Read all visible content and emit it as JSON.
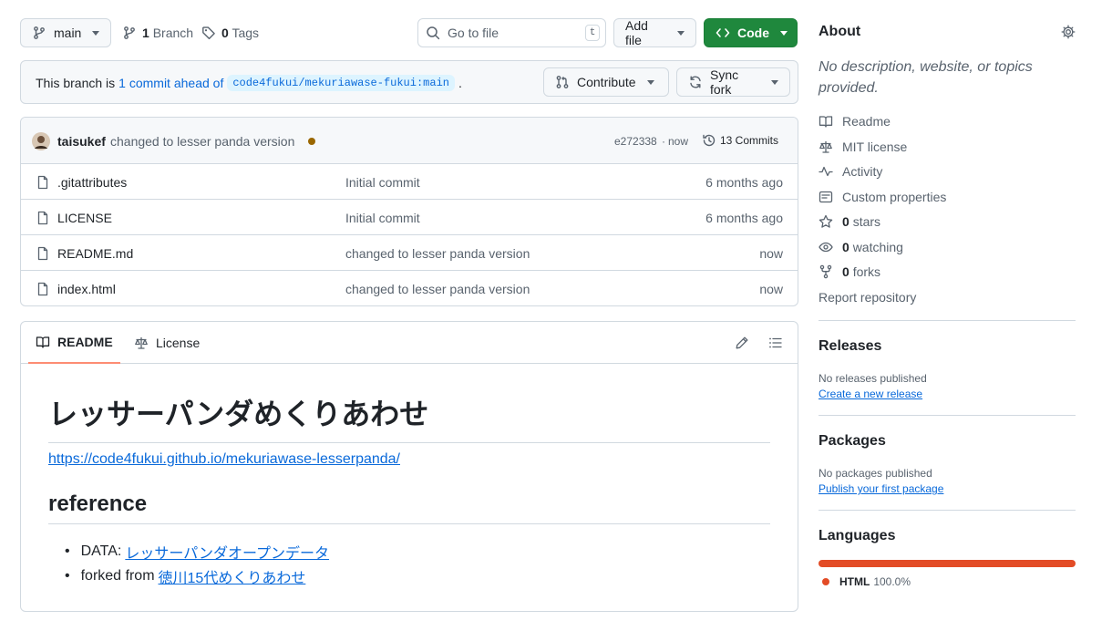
{
  "toolbar": {
    "branch_label": "main",
    "branch_count": "1",
    "branch_text": "Branch",
    "tag_count": "0",
    "tag_text": "Tags",
    "search_placeholder": "Go to file",
    "search_shortcut": "t",
    "add_file_label": "Add file",
    "code_label": "Code"
  },
  "banner": {
    "prefix": "This branch is",
    "ahead_link": "1 commit ahead of",
    "upstream": "code4fukui/mekuriawase-fukui:main",
    "suffix": ".",
    "contribute_label": "Contribute",
    "sync_label": "Sync fork"
  },
  "commit": {
    "author": "taisukef",
    "message": "changed to lesser panda version",
    "hash": "e272338",
    "separator": "·",
    "time": "now",
    "commits_label": "13 Commits"
  },
  "files": [
    {
      "name": ".gitattributes",
      "message": "Initial commit",
      "time": "6 months ago"
    },
    {
      "name": "LICENSE",
      "message": "Initial commit",
      "time": "6 months ago"
    },
    {
      "name": "README.md",
      "message": "changed to lesser panda version",
      "time": "now"
    },
    {
      "name": "index.html",
      "message": "changed to lesser panda version",
      "time": "now"
    }
  ],
  "readme": {
    "tab_readme": "README",
    "tab_license": "License",
    "title": "レッサーパンダめくりあわせ",
    "url": "https://code4fukui.github.io/mekuriawase-lesserpanda/",
    "h2": "reference",
    "list": [
      {
        "prefix": "DATA:",
        "link": "レッサーパンダオープンデータ"
      },
      {
        "prefix": "forked from",
        "link": "徳川15代めくりあわせ"
      }
    ]
  },
  "sidebar": {
    "about_title": "About",
    "description": "No description, website, or topics provided.",
    "readme": "Readme",
    "license": "MIT license",
    "activity": "Activity",
    "custom_properties": "Custom properties",
    "stars_count": "0",
    "stars_label": "stars",
    "watching_count": "0",
    "watching_label": "watching",
    "forks_count": "0",
    "forks_label": "forks",
    "report": "Report repository",
    "releases_title": "Releases",
    "releases_empty": "No releases published",
    "releases_link": "Create a new release",
    "packages_title": "Packages",
    "packages_empty": "No packages published",
    "packages_link": "Publish your first package",
    "languages_title": "Languages",
    "language_name": "HTML",
    "language_percent": "100.0%",
    "language_fraction": 1.0,
    "language_color": "#e34c26"
  },
  "colors": {
    "link": "#0969da",
    "code_button": "#1f883d",
    "commit_dot": "#9a6700"
  }
}
